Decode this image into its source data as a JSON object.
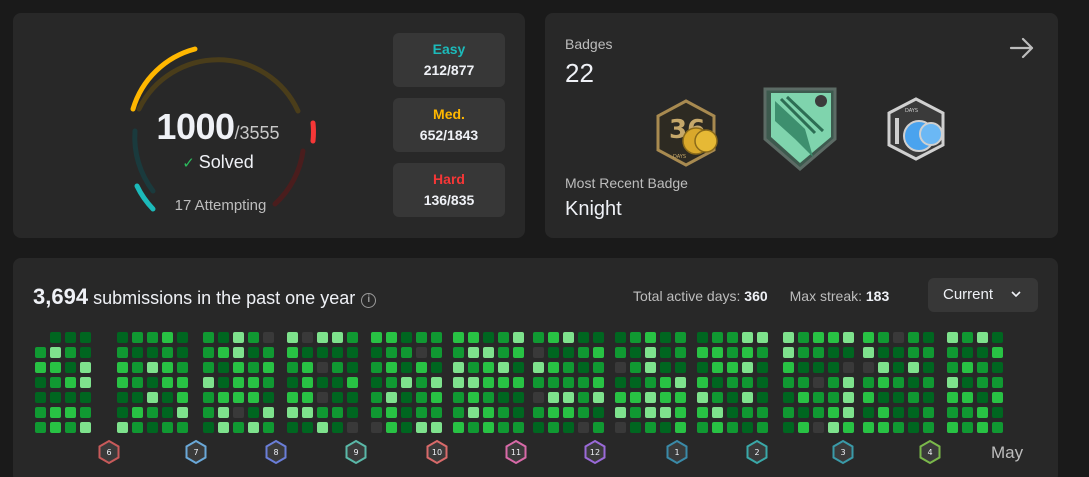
{
  "stats": {
    "solved": "1000",
    "total": "/3555",
    "solved_label": "Solved",
    "attempting": "17 Attempting",
    "colors": {
      "easy": "#1cbaba",
      "medium": "#ffb700",
      "hard": "#f63737"
    },
    "difficulty": [
      {
        "label": "Easy",
        "value": "212/877",
        "color": "#1cbaba"
      },
      {
        "label": "Med.",
        "value": "652/1843",
        "color": "#ffb700"
      },
      {
        "label": "Hard",
        "value": "136/835",
        "color": "#f63737"
      }
    ]
  },
  "badges": {
    "label": "Badges",
    "count": "22",
    "arrow_icon": "arrow-right-icon",
    "recent_label": "Most Recent Badge",
    "recent": "Knight",
    "items": [
      "365-days-badge-icon",
      "knight-badge-icon",
      "100-days-badge-icon"
    ]
  },
  "calendar": {
    "count": "3,694",
    "title_suffix": " submissions in the past one year",
    "active_label": "Total active days: ",
    "active_value": "360",
    "streak_label": "Max streak: ",
    "streak_value": "183",
    "select_value": "Current",
    "month_badges": [
      "6",
      "7",
      "8",
      "9",
      "10",
      "11",
      "12",
      "1",
      "2",
      "3",
      "4"
    ],
    "last_month_label": "May",
    "palette": [
      "#393939",
      "#006620",
      "#109932",
      "#28c244",
      "#7ee28d"
    ]
  }
}
